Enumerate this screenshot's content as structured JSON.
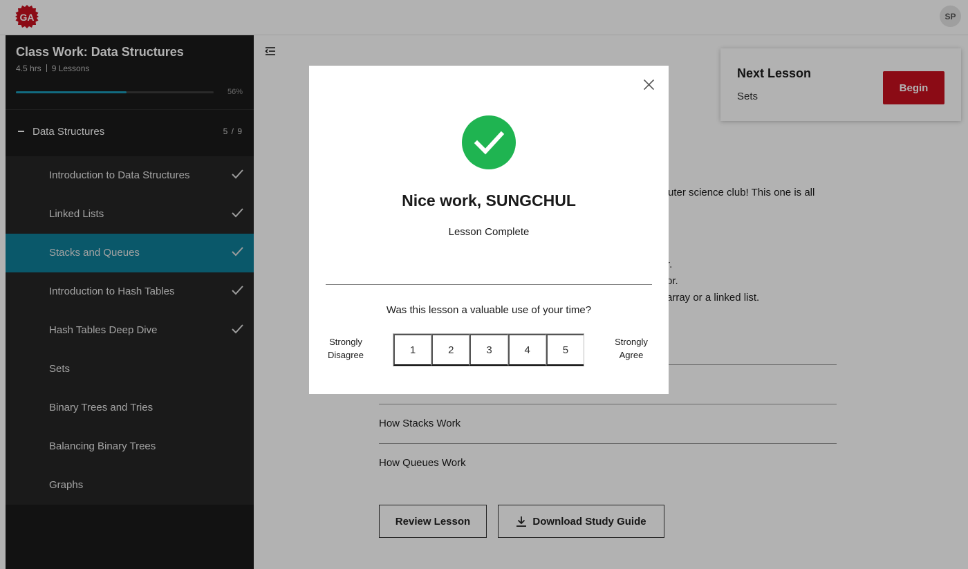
{
  "topbar": {
    "logo_text": "GA",
    "avatar_initials": "SP"
  },
  "sidebar": {
    "course_title": "Class Work: Data Structures",
    "duration": "4.5 hrs",
    "lesson_count": "9 Lessons",
    "progress_pct_label": "56%",
    "progress_value": 0.56,
    "section": {
      "title": "Data Structures",
      "count": "5 / 9"
    },
    "lessons": [
      {
        "label": "Introduction to Data Structures",
        "completed": true,
        "active": false
      },
      {
        "label": "Linked Lists",
        "completed": true,
        "active": false
      },
      {
        "label": "Stacks and Queues",
        "completed": true,
        "active": true
      },
      {
        "label": "Introduction to Hash Tables",
        "completed": true,
        "active": false
      },
      {
        "label": "Hash Tables Deep Dive",
        "completed": true,
        "active": false
      },
      {
        "label": "Sets",
        "completed": false,
        "active": false
      },
      {
        "label": "Binary Trees and Tries",
        "completed": false,
        "active": false
      },
      {
        "label": "Balancing Binary Trees",
        "completed": false,
        "active": false
      },
      {
        "label": "Graphs",
        "completed": false,
        "active": false
      }
    ]
  },
  "main": {
    "next_lesson": {
      "title": "Next Lesson",
      "name": "Sets",
      "begin_label": "Begin"
    },
    "partial_text": {
      "line1": "uter science club! This one is all",
      "line2": "r.",
      "line3": "or.",
      "line4": "array or a linked list."
    },
    "topics": [
      "How Stacks Work",
      "How Queues Work"
    ],
    "review_label": "Review Lesson",
    "download_label": "Download Study Guide"
  },
  "modal": {
    "title": "Nice work, SUNGCHUL",
    "subtitle": "Lesson Complete",
    "question": "Was this lesson a valuable use of your time?",
    "scale_left_line1": "Strongly",
    "scale_left_line2": "Disagree",
    "scale_right_line1": "Strongly",
    "scale_right_line2": "Agree",
    "scale_options": [
      "1",
      "2",
      "3",
      "4",
      "5"
    ]
  },
  "colors": {
    "brand_red": "#c8111f",
    "active_teal": "#0f7f99",
    "progress_blue": "#1a9ab8",
    "success_green": "#1fb451"
  },
  "icons": [
    "ga-logo-icon",
    "check-icon",
    "collapse-sidebar-icon",
    "download-icon",
    "close-icon",
    "success-check-icon"
  ]
}
